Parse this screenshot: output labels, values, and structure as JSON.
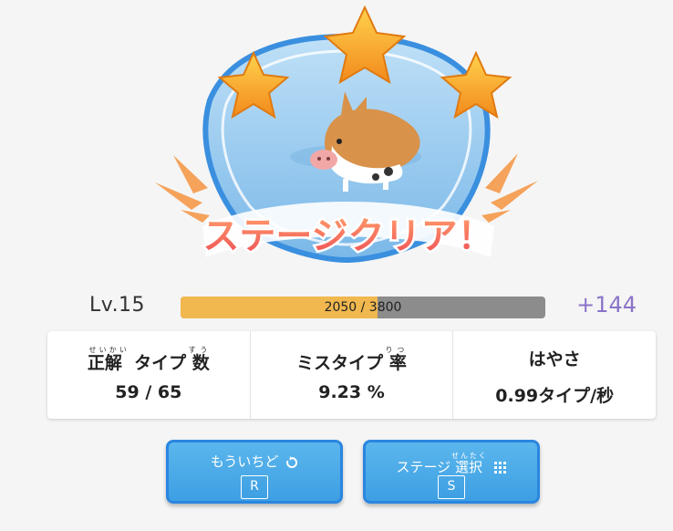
{
  "result": {
    "banner_text": "ステージクリア！",
    "stars_earned": 3,
    "stars_total": 3
  },
  "level": {
    "label": "Lv.15",
    "progress_text": "2050 / 3800",
    "progress_current": 2050,
    "progress_max": 3800,
    "gain": "+144"
  },
  "stats": [
    {
      "base": "正解タイプ数",
      "ruby": [
        {
          "rb": "正解",
          "rt": "せいかい"
        },
        {
          "text": "タイプ"
        },
        {
          "rb": "数",
          "rt": "すう"
        }
      ],
      "value": "59 / 65"
    },
    {
      "base": "ミスタイプ率",
      "ruby": [
        {
          "text": "ミスタイプ"
        },
        {
          "rb": "率",
          "rt": "りつ"
        }
      ],
      "value": "9.23 %"
    },
    {
      "base": "はやさ",
      "ruby": [
        {
          "text": "はやさ"
        }
      ],
      "value": "0.99タイプ/秒"
    }
  ],
  "buttons": {
    "retry": {
      "label": "もういちど",
      "key": "R",
      "icon": "retry-icon"
    },
    "stage_select": {
      "label_pre": "ステージ",
      "rb": "選択",
      "rt": "せんたく",
      "key": "S",
      "icon": "grid-icon"
    }
  },
  "colors": {
    "progress_fill": "#f0b84e",
    "progress_track": "#8c8c8c",
    "gain": "#8a73c9",
    "button": "#3d9fe3",
    "button_border": "#2a86e0",
    "star": "#f5a623",
    "banner_fill": "#f26b5b"
  }
}
